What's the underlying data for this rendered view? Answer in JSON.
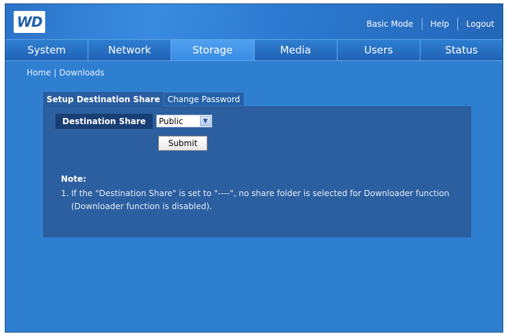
{
  "header": {
    "logo_text": "WD",
    "links": [
      "Basic Mode",
      "Help",
      "Logout"
    ]
  },
  "nav": {
    "tabs": [
      {
        "label": "System",
        "active": false
      },
      {
        "label": "Network",
        "active": false
      },
      {
        "label": "Storage",
        "active": true
      },
      {
        "label": "Media",
        "active": false
      },
      {
        "label": "Users",
        "active": false
      },
      {
        "label": "Status",
        "active": false
      }
    ]
  },
  "breadcrumb": {
    "home": "Home",
    "separator": "|",
    "current": "Downloads"
  },
  "subtabs": {
    "setup": "Setup Destination Share",
    "change_password": "Change Password"
  },
  "form": {
    "destination_label": "Destination Share",
    "destination_value": "Public",
    "submit_label": "Submit"
  },
  "note": {
    "title": "Note:",
    "number": "1.",
    "text": "If the \"Destination Share\" is set to \"----\", no share folder is selected for Downloader function (Downloader function is disabled)."
  },
  "colors": {
    "background": "#2f7fd0",
    "panel": "#2c5f9f",
    "label_bg": "#173f74"
  }
}
